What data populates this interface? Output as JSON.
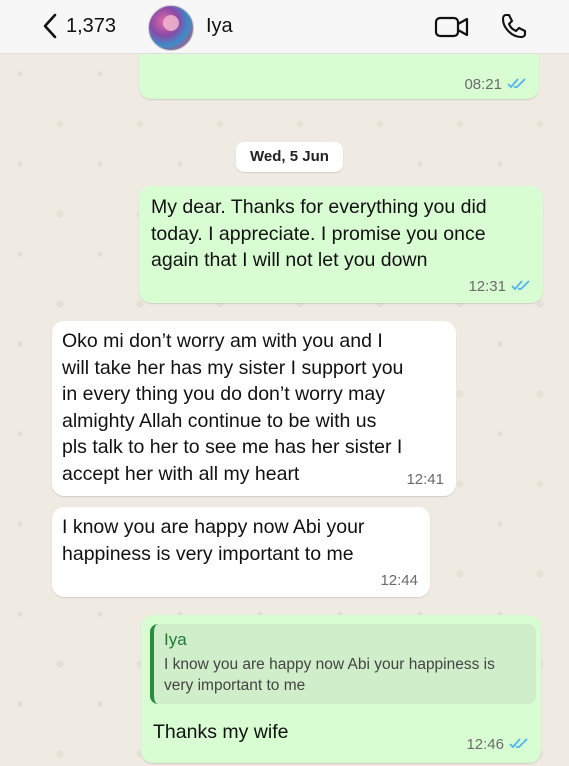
{
  "header": {
    "back_count": "1,373",
    "contact_name": "Iya",
    "icons": {
      "back": "chevron-left-icon",
      "video": "video-camera-icon",
      "call": "phone-icon"
    }
  },
  "colors": {
    "outgoing_bubble": "#d9fdd3",
    "incoming_bubble": "#ffffff",
    "chat_background": "#efeae2",
    "read_ticks": "#4fb6ec",
    "reply_accent": "#2a8c3e"
  },
  "chat": {
    "partial_message": {
      "time": "08:21",
      "status": "read"
    },
    "date_separator": "Wed, 5 Jun",
    "messages": [
      {
        "direction": "outgoing",
        "text": "My dear. Thanks for everything you did\ntoday. I appreciate. I promise you once\nagain that I will not let you down",
        "time": "12:31",
        "status": "read"
      },
      {
        "direction": "incoming",
        "text": "Oko mi don’t worry am with you and I\nwill take her has my sister I support you\nin every thing you do don’t worry may\nalmighty Allah continue to be with us\npls talk to her to see me has her sister I\naccept her with all my heart",
        "time": "12:41"
      },
      {
        "direction": "incoming",
        "text": "I know you are happy now Abi your\nhappiness is very important to me",
        "time": "12:44"
      },
      {
        "direction": "outgoing",
        "reply_to": {
          "name": "Iya",
          "text": "I know you are happy now Abi your happiness is\nvery important to me"
        },
        "text": "Thanks my wife",
        "time": "12:46",
        "status": "read"
      }
    ]
  }
}
